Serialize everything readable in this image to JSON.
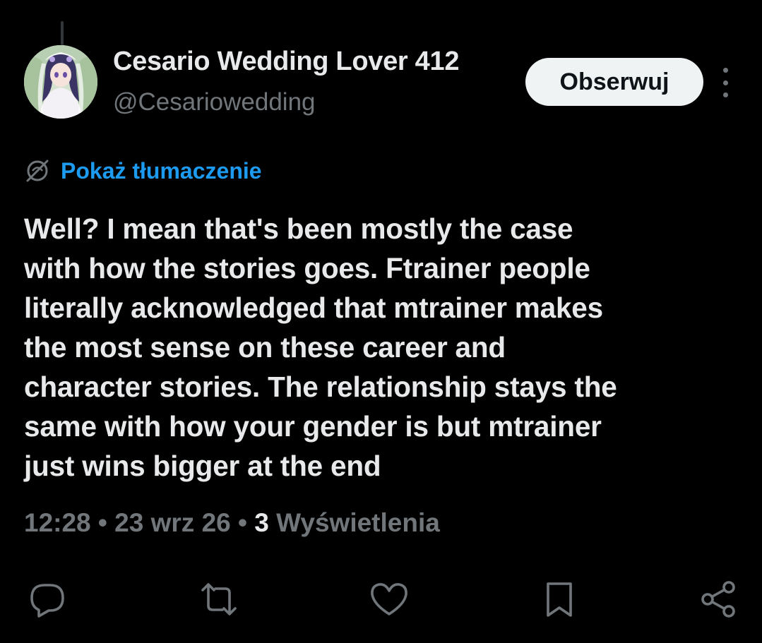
{
  "author": {
    "display_name": "Cesario Wedding Lover 412",
    "handle": "@Cesariowedding",
    "avatar_icon": "avatar-anime-bride-image"
  },
  "follow_button": {
    "label": "Obserwuj"
  },
  "more_menu": {
    "icon": "more-vertical-icon"
  },
  "translate": {
    "label": "Pokaż tłumaczenie",
    "icon": "globe-translate-icon"
  },
  "tweet": {
    "lines": [
      "Well? I mean that's been mostly the case",
      "with how the stories goes. Ftrainer people",
      "literally acknowledged that mtrainer makes",
      "the most sense on these career and",
      "character stories. The relationship stays the",
      "same with how your gender is but mtrainer",
      "just wins bigger at the end"
    ]
  },
  "meta": {
    "time": "12:28",
    "separator": "•",
    "date": "23 wrz 26",
    "views_count": "3",
    "views_label": "Wyświetlenia"
  },
  "actions": [
    {
      "name": "reply",
      "icon": "reply-bubble-icon"
    },
    {
      "name": "repost",
      "icon": "repost-icon"
    },
    {
      "name": "like",
      "icon": "heart-icon"
    },
    {
      "name": "bookmark",
      "icon": "bookmark-icon"
    },
    {
      "name": "share",
      "icon": "share-icon"
    }
  ],
  "colors": {
    "background": "#000000",
    "text_primary": "#e7e9ea",
    "text_secondary": "#71767b",
    "accent_link": "#1d9bf0",
    "follow_button_bg": "#eff3f4"
  }
}
